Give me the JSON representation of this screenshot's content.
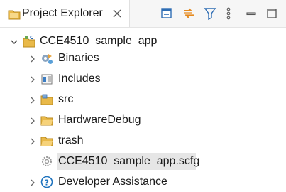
{
  "view": {
    "tab_label": "Project Explorer",
    "tab_icon": "folder-tree-icon",
    "toolbar": {
      "collapse_all": "collapse-all-icon",
      "link_editor": "link-with-editor-icon",
      "filter": "filter-icon",
      "view_menu": "view-menu-icon",
      "minimize": "minimize-icon",
      "maximize": "maximize-icon"
    }
  },
  "tree": {
    "project": {
      "label": "CCE4510_sample_app",
      "expanded": true,
      "icon": "c-project-icon"
    },
    "children": [
      {
        "label": "Binaries",
        "icon": "binaries-icon",
        "expandable": true
      },
      {
        "label": "Includes",
        "icon": "includes-icon",
        "expandable": true
      },
      {
        "label": "src",
        "icon": "source-folder-icon",
        "expandable": true
      },
      {
        "label": "HardwareDebug",
        "icon": "folder-icon",
        "expandable": true
      },
      {
        "label": "trash",
        "icon": "folder-icon",
        "expandable": true
      },
      {
        "label": "CCE4510_sample_app.scfg",
        "icon": "config-file-icon",
        "expandable": false,
        "selected": true
      },
      {
        "label": "Developer Assistance",
        "icon": "help-icon",
        "expandable": true
      }
    ]
  },
  "colors": {
    "folder": "#e9b949",
    "source_folder": "#7aa7d8",
    "help": "#1e73be",
    "selection": "#e6e6e6"
  }
}
